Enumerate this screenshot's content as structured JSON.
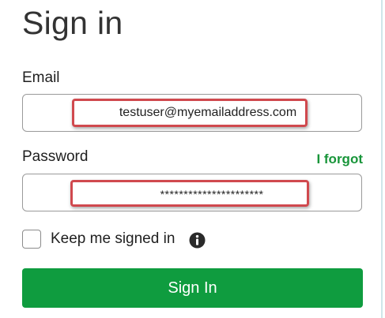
{
  "page": {
    "title": "Sign in"
  },
  "form": {
    "email": {
      "label": "Email",
      "value": "testuser@myemailaddress.com"
    },
    "password": {
      "label": "Password",
      "value": "**********************",
      "forgot_link": "I forgot"
    },
    "keep_signed_in": {
      "label": "Keep me signed in",
      "checked": false,
      "info_icon": "info-icon"
    },
    "submit_label": "Sign In"
  },
  "colors": {
    "accent_green": "#0f9c3f",
    "link_green": "#18953a",
    "highlight_red": "#d0494e"
  }
}
